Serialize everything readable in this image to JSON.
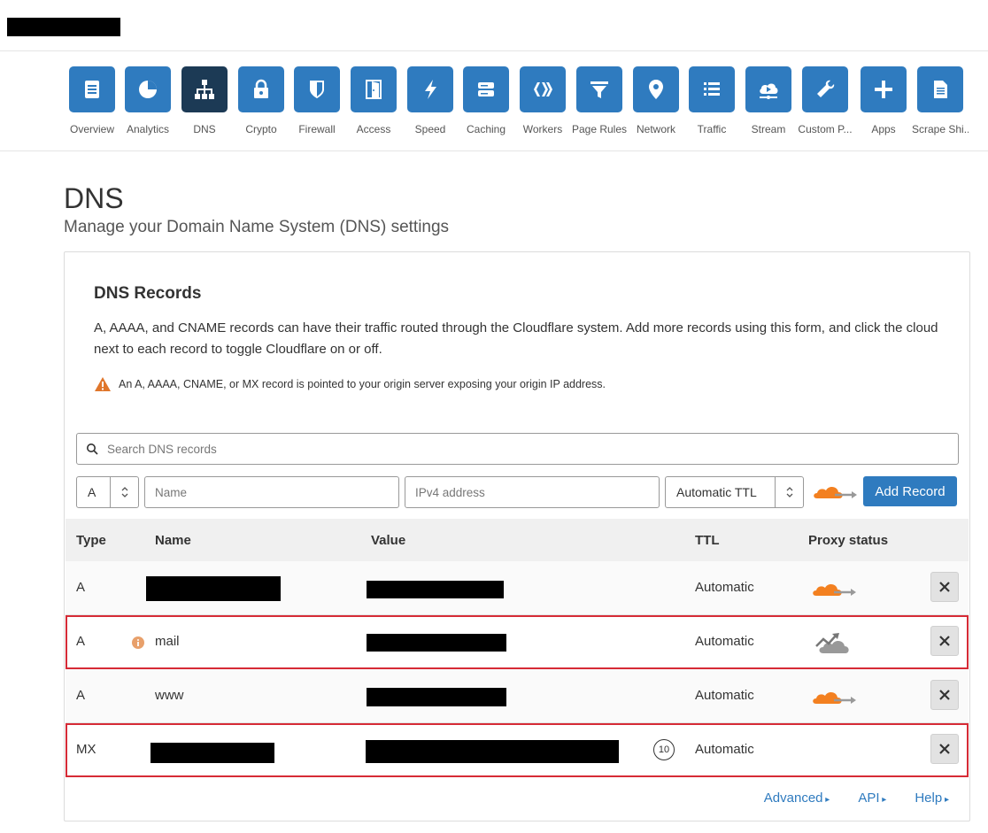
{
  "nav": {
    "items": [
      {
        "label": "Overview",
        "icon": "document-icon",
        "active": false
      },
      {
        "label": "Analytics",
        "icon": "pie-chart-icon",
        "active": false
      },
      {
        "label": "DNS",
        "icon": "network-tree-icon",
        "active": true
      },
      {
        "label": "Crypto",
        "icon": "lock-icon",
        "active": false
      },
      {
        "label": "Firewall",
        "icon": "shield-icon",
        "active": false
      },
      {
        "label": "Access",
        "icon": "door-icon",
        "active": false
      },
      {
        "label": "Speed",
        "icon": "lightning-icon",
        "active": false
      },
      {
        "label": "Caching",
        "icon": "server-icon",
        "active": false
      },
      {
        "label": "Workers",
        "icon": "workers-icon",
        "active": false
      },
      {
        "label": "Page Rules",
        "icon": "filter-icon",
        "active": false
      },
      {
        "label": "Network",
        "icon": "location-pin-icon",
        "active": false
      },
      {
        "label": "Traffic",
        "icon": "list-icon",
        "active": false
      },
      {
        "label": "Stream",
        "icon": "cloud-play-icon",
        "active": false
      },
      {
        "label": "Custom P...",
        "icon": "wrench-icon",
        "active": false
      },
      {
        "label": "Apps",
        "icon": "plus-icon",
        "active": false
      },
      {
        "label": "Scrape Shi...",
        "icon": "document-lines-icon",
        "active": false
      }
    ]
  },
  "page": {
    "title": "DNS",
    "subtitle": "Manage your Domain Name System (DNS) settings"
  },
  "card": {
    "title": "DNS Records",
    "description": "A, AAAA, and CNAME records can have their traffic routed through the Cloudflare system. Add more records using this form, and click the cloud next to each record to toggle Cloudflare on or off.",
    "warning": "An A, AAAA, CNAME, or MX record is pointed to your origin server exposing your origin IP address."
  },
  "search": {
    "placeholder": "Search DNS records"
  },
  "form": {
    "type_value": "A",
    "name_placeholder": "Name",
    "value_placeholder": "IPv4 address",
    "ttl_value": "Automatic TTL",
    "add_label": "Add Record"
  },
  "table": {
    "headers": {
      "type": "Type",
      "name": "Name",
      "value": "Value",
      "ttl": "TTL",
      "proxy": "Proxy status"
    },
    "rows": [
      {
        "type": "A",
        "name": "",
        "ttl": "Automatic",
        "proxied": true
      },
      {
        "type": "A",
        "name": "mail",
        "ttl": "Automatic",
        "proxied": false
      },
      {
        "type": "A",
        "name": "www",
        "ttl": "Automatic",
        "proxied": true
      },
      {
        "type": "MX",
        "name": "",
        "priority": "10",
        "ttl": "Automatic",
        "proxied": null
      }
    ]
  },
  "footer": {
    "advanced": "Advanced",
    "api": "API",
    "help": "Help"
  },
  "colors": {
    "accent": "#2f7bbf",
    "active_nav": "#1c3a55",
    "cloud_orange": "#f38020",
    "highlight_red": "#d62b36"
  }
}
